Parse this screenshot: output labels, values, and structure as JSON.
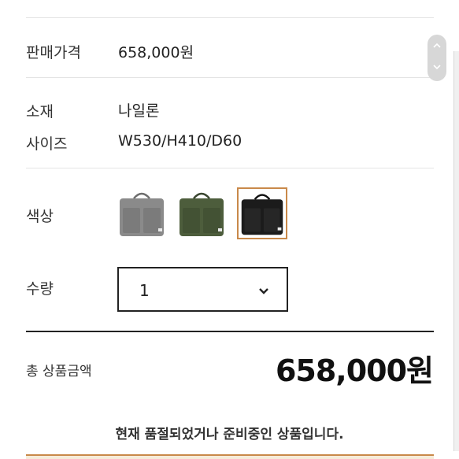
{
  "product": {
    "price_label": "판매가격",
    "price_value": "658,000원",
    "material_label": "소재",
    "material_value": "나일론",
    "size_label": "사이즈",
    "size_value": "W530/H410/D60"
  },
  "color": {
    "label": "색상",
    "options": [
      {
        "name": "gray",
        "hex": "#8a8a8a",
        "selected": false
      },
      {
        "name": "olive",
        "hex": "#4d5d3c",
        "selected": false
      },
      {
        "name": "black",
        "hex": "#1b1b1b",
        "selected": true
      }
    ],
    "selected_border": "#c9894a"
  },
  "quantity": {
    "label": "수량",
    "value": "1",
    "chevron": "chevron-down-icon"
  },
  "total": {
    "label": "총 상품금액",
    "value": "658,000원"
  },
  "notice": "현재 품절되었거나 준비중인 상품입니다."
}
